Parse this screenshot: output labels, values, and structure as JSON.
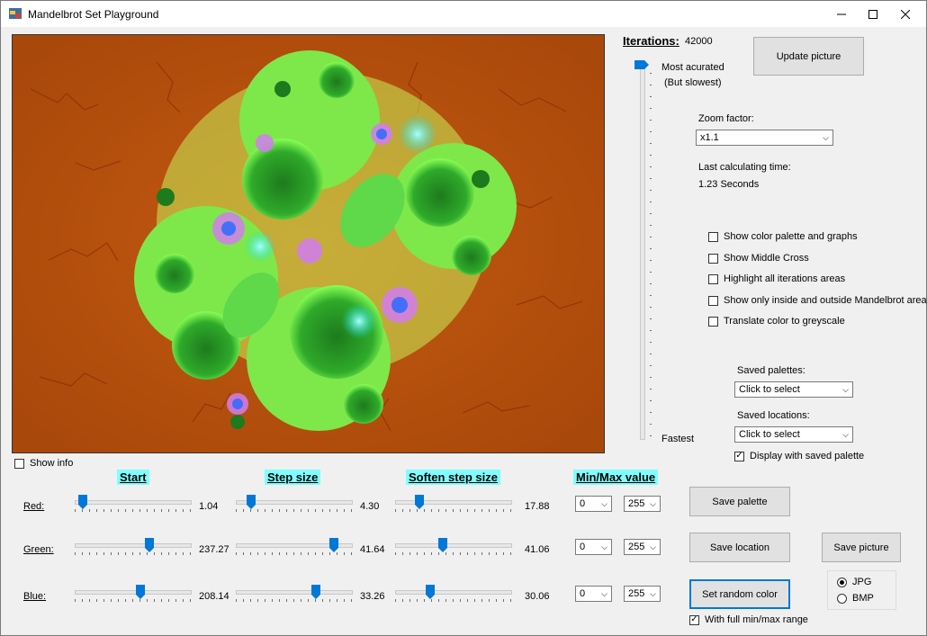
{
  "window": {
    "title": "Mandelbrot Set Playground"
  },
  "iterations": {
    "label": "Iterations:",
    "value": "42000",
    "slider_level": 0.0,
    "top_label": "Most acurated",
    "top_sublabel": "(But slowest)",
    "bottom_label": "Fastest"
  },
  "buttons": {
    "update": "Update picture",
    "save_palette": "Save  palette",
    "save_location": "Save location",
    "save_picture": "Save picture",
    "random_color": "Set random color"
  },
  "zoom": {
    "label": "Zoom factor:",
    "value": "x1.1"
  },
  "calc": {
    "label": "Last calculating time:",
    "value": "1.23 Seconds"
  },
  "options": [
    {
      "label": "Show color palette and graphs",
      "checked": false
    },
    {
      "label": "Show Middle Cross",
      "checked": false
    },
    {
      "label": "Highlight all iterations areas",
      "checked": false
    },
    {
      "label": "Show only inside and outside Mandelbrot areas",
      "checked": false
    },
    {
      "label": "Translate color to greyscale",
      "checked": false
    }
  ],
  "saved_palettes": {
    "label": "Saved palettes:",
    "value": "Click to select"
  },
  "saved_locations": {
    "label": "Saved locations:",
    "value": "Click to select"
  },
  "display_palette": {
    "label": "Display with saved palette",
    "checked": true
  },
  "show_info": {
    "label": "Show info",
    "checked": false
  },
  "headers": {
    "start": "Start",
    "step": "Step size",
    "soften": "Soften step size",
    "minmax": "Min/Max value"
  },
  "channels": [
    {
      "name": "Red:",
      "start": {
        "value": "1.04",
        "level": 0.03
      },
      "step": {
        "value": "4.30",
        "level": 0.1
      },
      "soften": {
        "value": "17.88",
        "level": 0.18
      },
      "min": "0",
      "max": "255"
    },
    {
      "name": "Green:",
      "start": {
        "value": "237.27",
        "level": 0.65
      },
      "step": {
        "value": "41.64",
        "level": 0.87
      },
      "soften": {
        "value": "41.06",
        "level": 0.4
      },
      "min": "0",
      "max": "255"
    },
    {
      "name": "Blue:",
      "start": {
        "value": "208.14",
        "level": 0.57
      },
      "step": {
        "value": "33.26",
        "level": 0.7
      },
      "soften": {
        "value": "30.06",
        "level": 0.28
      },
      "min": "0",
      "max": "255"
    }
  ],
  "format": {
    "options": [
      "JPG",
      "BMP"
    ],
    "selected": "JPG"
  },
  "full_range": {
    "label": "With full min/max range",
    "checked": true
  }
}
